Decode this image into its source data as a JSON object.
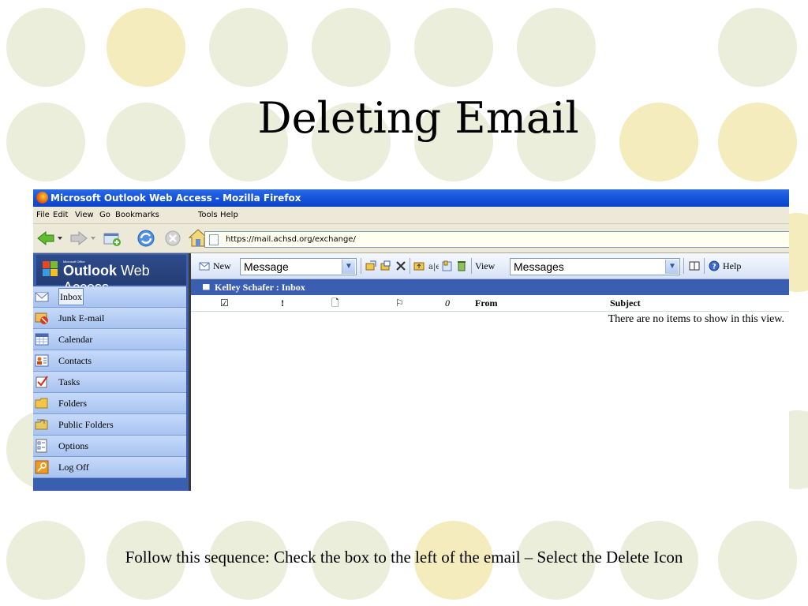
{
  "slide": {
    "title": "Deleting Email",
    "caption": "Follow this sequence:  Check the box to the left of the email – Select the Delete Icon"
  },
  "colors": {
    "dot_light": "#eaeedb",
    "dot_yellow": "#f4ecbd",
    "xp_titlebar": "#1250d8",
    "owa_sidebar": "#3b5fb0",
    "owa_nav_item": "#b9cff5"
  },
  "browser": {
    "window_title": "Microsoft Outlook Web Access - Mozilla Firefox",
    "menu": [
      "File",
      "Edit",
      "View",
      "Go",
      "Bookmarks",
      "Tools",
      "Help"
    ],
    "url": "https://mail.achsd.org/exchange/",
    "nav_icons": [
      "back-arrow-icon",
      "forward-arrow-icon",
      "new-window-icon",
      "refresh-icon",
      "stop-icon",
      "home-icon"
    ]
  },
  "owa": {
    "logo_small": "Microsoft Office",
    "logo_bold": "Outlook",
    "logo_rest": " Web Access",
    "nav": [
      {
        "label": "Inbox",
        "icon": "inbox-icon"
      },
      {
        "label": "Junk E-mail",
        "icon": "junk-mail-icon"
      },
      {
        "label": "Calendar",
        "icon": "calendar-icon"
      },
      {
        "label": "Contacts",
        "icon": "contacts-icon"
      },
      {
        "label": "Tasks",
        "icon": "tasks-icon"
      },
      {
        "label": "Folders",
        "icon": "folder-icon"
      },
      {
        "label": "Public Folders",
        "icon": "public-folders-icon"
      },
      {
        "label": "Options",
        "icon": "options-icon"
      },
      {
        "label": "Log Off",
        "icon": "log-off-icon"
      }
    ],
    "toolbar": {
      "new_label": "New",
      "new_type": "Message",
      "view_label": "View",
      "view_type": "Messages",
      "help_label": "Help",
      "action_icons": [
        "move-icon",
        "copy-icon",
        "delete-icon",
        "move-to-folder-icon",
        "check-names-icon",
        "address-book-icon",
        "empty-folder-icon",
        "address-book-view-icon",
        "help-icon"
      ]
    },
    "folder_path": "Kelley Schafer : Inbox",
    "columns": {
      "select": "☑",
      "importance": "!",
      "type": "🗋",
      "flag": "⚐",
      "attachment": "0",
      "from": "From",
      "subject": "Subject"
    },
    "empty_message": "There are no items to show in this view."
  }
}
